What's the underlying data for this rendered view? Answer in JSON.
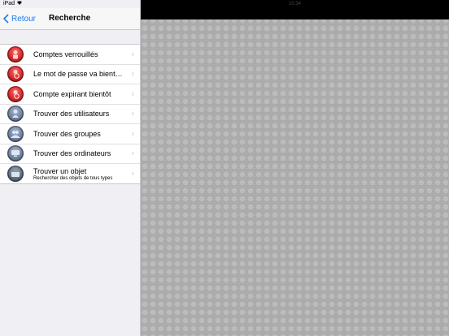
{
  "status_bar": {
    "carrier": "iPad",
    "time": "10:34"
  },
  "navbar": {
    "back_label": "Retour",
    "title": "Recherche"
  },
  "items": [
    {
      "label": "Comptes verrouillés",
      "icon": "locked-user-icon",
      "tone": "red"
    },
    {
      "label": "Le mot de passe va bientôt expirer",
      "icon": "password-expiring-icon",
      "tone": "red"
    },
    {
      "label": "Compte expirant bientôt",
      "icon": "account-expiring-icon",
      "tone": "red"
    },
    {
      "label": "Trouver des utilisateurs",
      "icon": "user-icon",
      "tone": "blue"
    },
    {
      "label": "Trouver des groupes",
      "icon": "group-icon",
      "tone": "blue"
    },
    {
      "label": "Trouver des ordinateurs",
      "icon": "computer-icon",
      "tone": "blue"
    },
    {
      "label": "Trouver un objet",
      "sublabel": "Rechercher des objets de tous types",
      "icon": "object-icon",
      "tone": "dark"
    }
  ]
}
